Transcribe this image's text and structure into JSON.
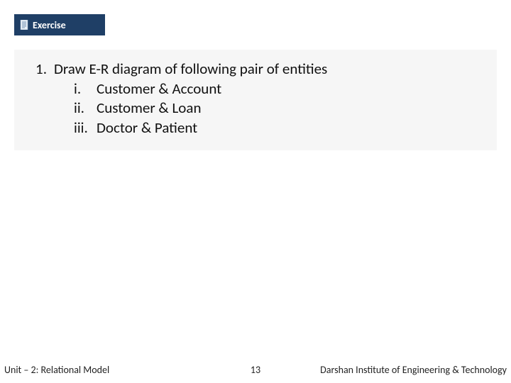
{
  "header": {
    "label": "Exercise"
  },
  "question": {
    "number": "1.",
    "text": "Draw E-R diagram of following pair of entities",
    "items": [
      {
        "num": "i.",
        "text": "Customer & Account"
      },
      {
        "num": "ii.",
        "text": "Customer & Loan"
      },
      {
        "num": "iii.",
        "text": "Doctor & Patient"
      }
    ]
  },
  "footer": {
    "left": "Unit – 2: Relational Model",
    "page": "13",
    "right": "Darshan Institute of Engineering & Technology"
  }
}
